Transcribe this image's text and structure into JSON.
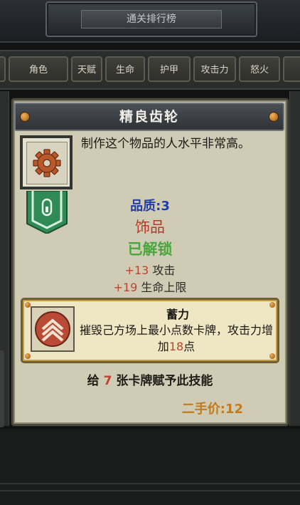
{
  "header": {
    "title": "通关排行榜"
  },
  "tabs": [
    "角色",
    "天赋",
    "生命",
    "护甲",
    "攻击力",
    "怒火"
  ],
  "item": {
    "name": "精良齿轮",
    "description": "制作这个物品的人水平非常高。",
    "quality_label": "品质:",
    "quality_value": "3",
    "category": "饰品",
    "status": "已解锁",
    "bonuses": [
      {
        "value": "+13",
        "label": "攻击"
      },
      {
        "value": "+19",
        "label": "生命上限"
      }
    ],
    "skill": {
      "name": "蓄力",
      "desc_before": "摧毁己方场上最小点数卡牌，攻击力增加",
      "desc_value": "18",
      "desc_after": "点"
    },
    "grant": {
      "before": "给 ",
      "count": "7",
      "after": " 张卡牌赋予此技能"
    },
    "price_label": "二手价:",
    "price_value": "12"
  },
  "icons": {
    "item": "gear-icon",
    "pennant": "unlock-pennant-icon",
    "skill": "chevron-up-icon"
  },
  "colors": {
    "quality": "#203ea3",
    "category": "#b33a2a",
    "unlocked": "#4aa63d",
    "highlight_number": "#c0432e",
    "price": "#c37a18",
    "pennant": "#2f8a55"
  }
}
